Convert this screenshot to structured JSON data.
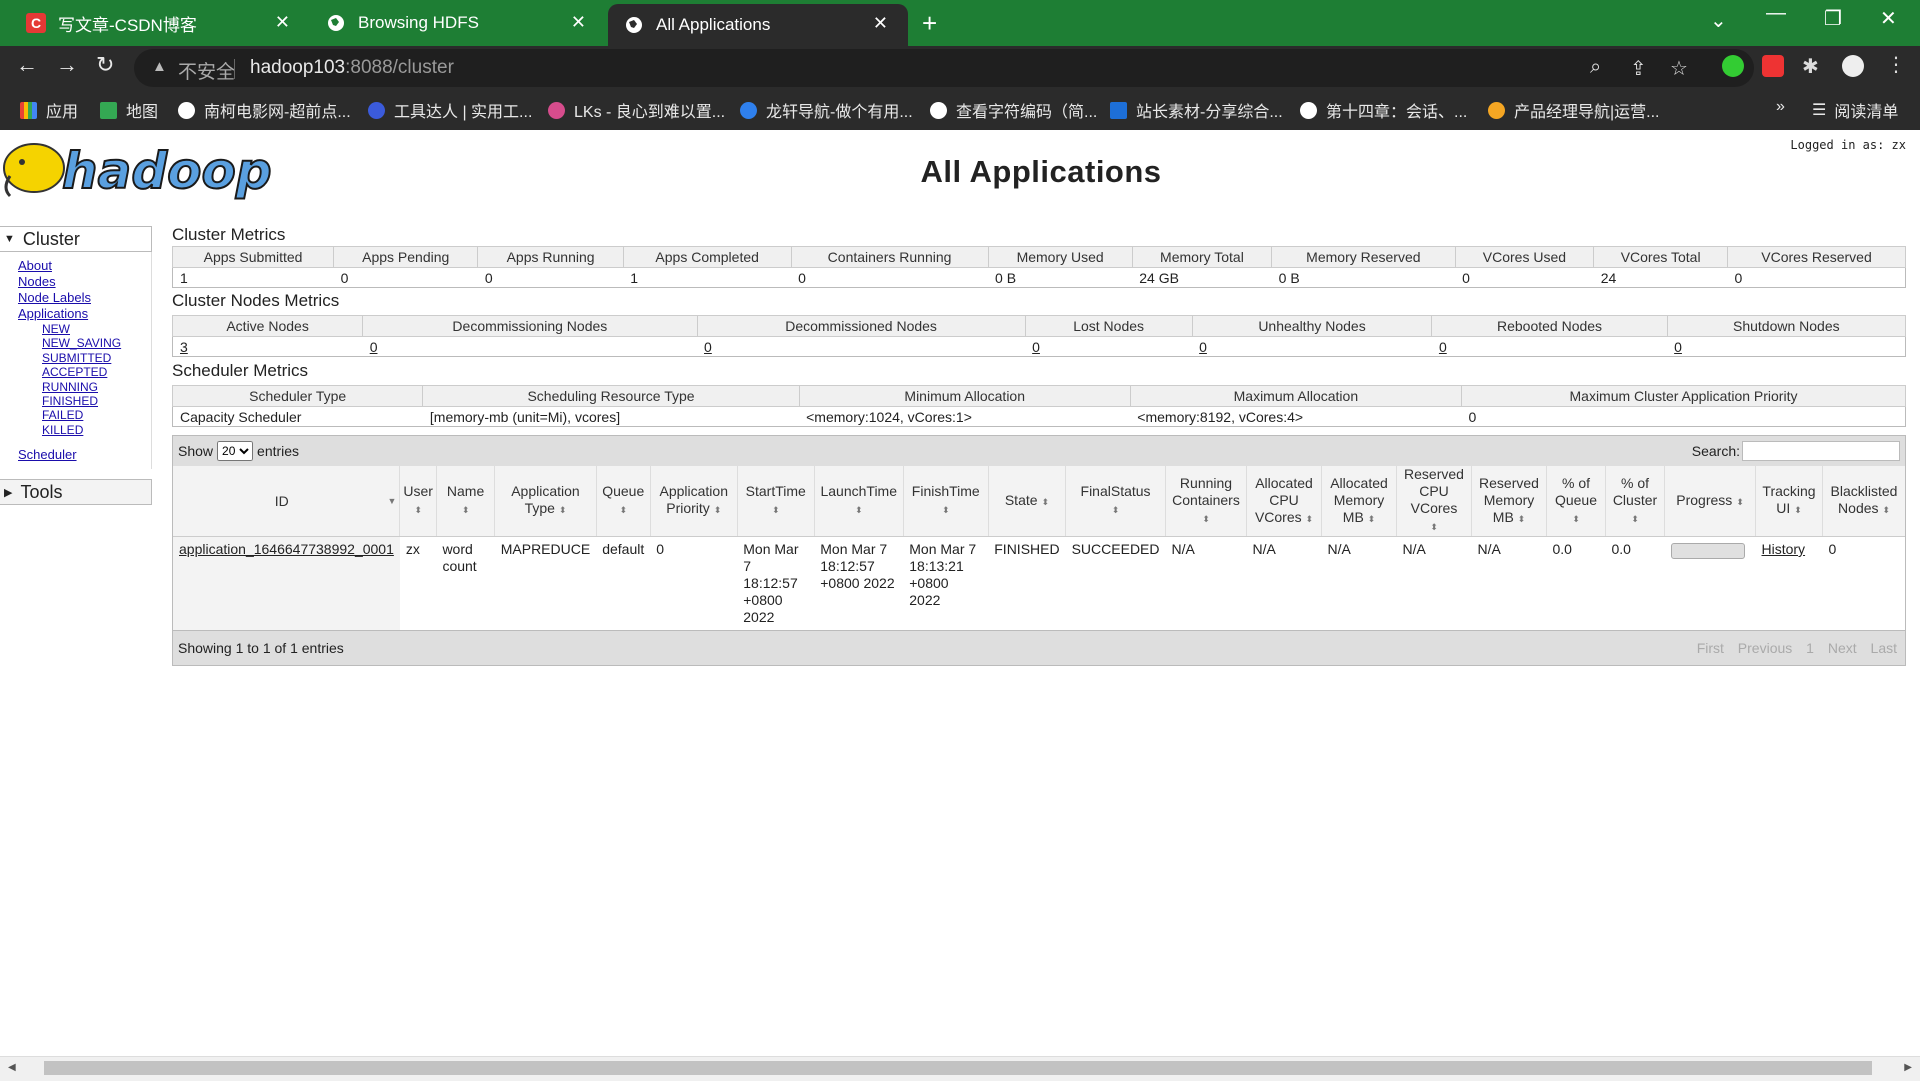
{
  "browser": {
    "tabs": [
      {
        "title": "写文章-CSDN博客",
        "icon": "csdn-icon"
      },
      {
        "title": "Browsing HDFS",
        "icon": "globe-icon"
      },
      {
        "title": "All Applications",
        "icon": "globe-icon"
      }
    ],
    "insecure_label": "不安全",
    "url_host": "hadoop103",
    "url_rest": ":8088/cluster",
    "bookmarks": [
      {
        "label": "应用",
        "color": "#e94235"
      },
      {
        "label": "地图",
        "color": "#34a853"
      },
      {
        "label": "南柯电影网-超前点...",
        "color": "#ffffff"
      },
      {
        "label": "工具达人 | 实用工...",
        "color": "#3b5bdb"
      },
      {
        "label": "LKs - 良心到难以置...",
        "color": "#d64c8c"
      },
      {
        "label": "龙轩导航-做个有用...",
        "color": "#2f80ed"
      },
      {
        "label": "查看字符编码（简...",
        "color": "#ffffff"
      },
      {
        "label": "站长素材-分享综合...",
        "color": "#1d6fd8"
      },
      {
        "label": "第十四章：会话、...",
        "color": "#ffffff"
      },
      {
        "label": "产品经理导航|运营...",
        "color": "#f5a623"
      }
    ],
    "reading_list": "阅读清单"
  },
  "page": {
    "logo_text": "hadoop",
    "logged_in": "Logged in as: zx",
    "title": "All Applications"
  },
  "nav": {
    "cluster": "Cluster",
    "about": "About",
    "nodes": "Nodes",
    "node_labels": "Node Labels",
    "applications": "Applications",
    "states": [
      "NEW",
      "NEW_SAVING",
      "SUBMITTED",
      "ACCEPTED",
      "RUNNING",
      "FINISHED",
      "FAILED",
      "KILLED"
    ],
    "scheduler": "Scheduler",
    "tools": "Tools"
  },
  "cluster_metrics": {
    "title": "Cluster Metrics",
    "headers": [
      "Apps Submitted",
      "Apps Pending",
      "Apps Running",
      "Apps Completed",
      "Containers Running",
      "Memory Used",
      "Memory Total",
      "Memory Reserved",
      "VCores Used",
      "VCores Total",
      "VCores Reserved"
    ],
    "values": [
      "1",
      "0",
      "0",
      "1",
      "0",
      "0 B",
      "24 GB",
      "0 B",
      "0",
      "24",
      "0"
    ]
  },
  "node_metrics": {
    "title": "Cluster Nodes Metrics",
    "headers": [
      "Active Nodes",
      "Decommissioning Nodes",
      "Decommissioned Nodes",
      "Lost Nodes",
      "Unhealthy Nodes",
      "Rebooted Nodes",
      "Shutdown Nodes"
    ],
    "values": [
      "3",
      "0",
      "0",
      "0",
      "0",
      "0",
      "0"
    ]
  },
  "scheduler_metrics": {
    "title": "Scheduler Metrics",
    "headers": [
      "Scheduler Type",
      "Scheduling Resource Type",
      "Minimum Allocation",
      "Maximum Allocation",
      "Maximum Cluster Application Priority"
    ],
    "values": [
      "Capacity Scheduler",
      "[memory-mb (unit=Mi), vcores]",
      "<memory:1024, vCores:1>",
      "<memory:8192, vCores:4>",
      "0"
    ]
  },
  "apps_table": {
    "show_label": "Show",
    "page_size": "20",
    "entries_label": "entries",
    "search_label": "Search:",
    "headers": [
      "ID",
      "User",
      "Name",
      "Application Type",
      "Queue",
      "Application Priority",
      "StartTime",
      "LaunchTime",
      "FinishTime",
      "State",
      "FinalStatus",
      "Running Containers",
      "Allocated CPU VCores",
      "Allocated Memory MB",
      "Reserved CPU VCores",
      "Reserved Memory MB",
      "% of Queue",
      "% of Cluster",
      "Progress",
      "Tracking UI",
      "Blacklisted Nodes"
    ],
    "rows": [
      {
        "id": "application_1646647738992_0001",
        "user": "zx",
        "name": "word count",
        "type": "MAPREDUCE",
        "queue": "default",
        "priority": "0",
        "start": "Mon Mar 7 18:12:57 +0800 2022",
        "launch": "Mon Mar 7 18:12:57 +0800 2022",
        "finish": "Mon Mar 7 18:13:21 +0800 2022",
        "state": "FINISHED",
        "final_status": "SUCCEEDED",
        "running_containers": "N/A",
        "alloc_vcores": "N/A",
        "alloc_mem": "N/A",
        "res_vcores": "N/A",
        "res_mem": "N/A",
        "pct_queue": "0.0",
        "pct_cluster": "0.0",
        "progress": 0,
        "tracking": "History",
        "blacklisted": "0"
      }
    ],
    "showing": "Showing 1 to 1 of 1 entries",
    "pager": [
      "First",
      "Previous",
      "1",
      "Next",
      "Last"
    ]
  }
}
